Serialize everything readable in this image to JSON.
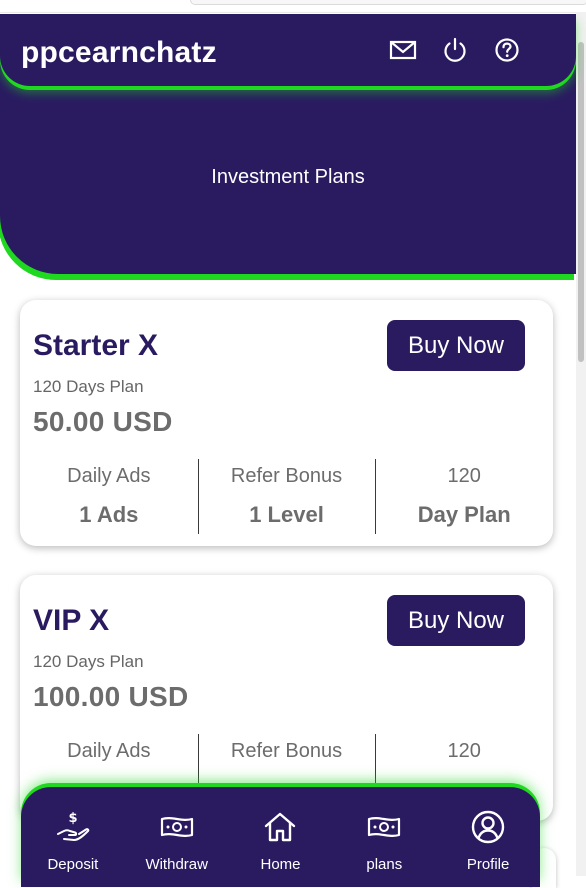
{
  "header": {
    "brand": "ppcearnchatz",
    "icons": [
      "mail-icon",
      "power-icon",
      "help-icon"
    ]
  },
  "hero": {
    "title": "Investment Plans"
  },
  "plans": [
    {
      "name": "Starter X",
      "buy_label": "Buy Now",
      "duration": "120 Days Plan",
      "price": "50.00 USD",
      "stats": [
        {
          "label": "Daily Ads",
          "value": "1 Ads"
        },
        {
          "label": "Refer Bonus",
          "value": "1 Level"
        },
        {
          "label": "120",
          "value": "Day Plan"
        }
      ]
    },
    {
      "name": "VIP X",
      "buy_label": "Buy Now",
      "duration": "120 Days Plan",
      "price": "100.00 USD",
      "stats": [
        {
          "label": "Daily Ads",
          "value": ""
        },
        {
          "label": "Refer Bonus",
          "value": ""
        },
        {
          "label": "120",
          "value": ""
        }
      ]
    }
  ],
  "bottom_nav": [
    {
      "label": "Deposit",
      "icon": "deposit-hand-dollar-icon"
    },
    {
      "label": "Withdraw",
      "icon": "banknote-icon"
    },
    {
      "label": "Home",
      "icon": "home-icon"
    },
    {
      "label": "plans",
      "icon": "banknote-icon"
    },
    {
      "label": "Profile",
      "icon": "user-circle-icon"
    }
  ],
  "colors": {
    "primary": "#2a1b61",
    "accent": "#1fd81f",
    "text_muted": "#6c6c6c"
  }
}
